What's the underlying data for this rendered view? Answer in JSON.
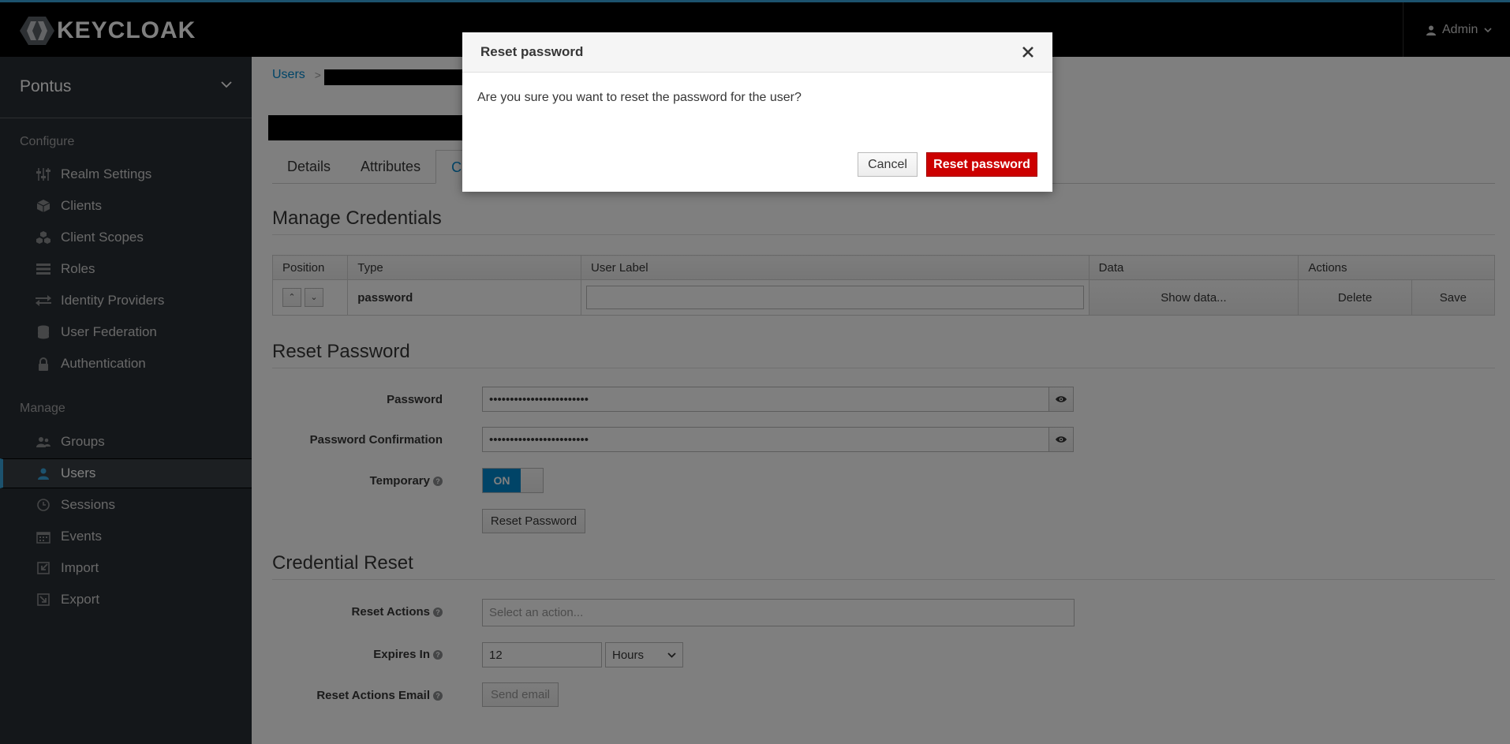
{
  "header": {
    "logo_text": "KEYCLOAK",
    "user_label": "Admin"
  },
  "sidebar": {
    "realm": "Pontus",
    "configure_heading": "Configure",
    "configure_items": [
      {
        "label": "Realm Settings",
        "icon": "sliders-icon"
      },
      {
        "label": "Clients",
        "icon": "cube-icon"
      },
      {
        "label": "Client Scopes",
        "icon": "cubes-icon"
      },
      {
        "label": "Roles",
        "icon": "list-icon"
      },
      {
        "label": "Identity Providers",
        "icon": "exchange-icon"
      },
      {
        "label": "User Federation",
        "icon": "database-icon"
      },
      {
        "label": "Authentication",
        "icon": "lock-icon"
      }
    ],
    "manage_heading": "Manage",
    "manage_items": [
      {
        "label": "Groups",
        "icon": "users-icon"
      },
      {
        "label": "Users",
        "icon": "user-icon",
        "active": true
      },
      {
        "label": "Sessions",
        "icon": "clock-icon"
      },
      {
        "label": "Events",
        "icon": "calendar-icon"
      },
      {
        "label": "Import",
        "icon": "import-icon"
      },
      {
        "label": "Export",
        "icon": "export-icon"
      }
    ]
  },
  "breadcrumb": {
    "root": "Users"
  },
  "tabs": [
    "Details",
    "Attributes",
    "C"
  ],
  "manage_credentials": {
    "title": "Manage Credentials",
    "columns": [
      "Position",
      "Type",
      "User Label",
      "Data",
      "Actions"
    ],
    "row": {
      "type": "password",
      "user_label": "",
      "data_button": "Show data...",
      "delete": "Delete",
      "save": "Save"
    }
  },
  "reset_password": {
    "title": "Reset Password",
    "password_label": "Password",
    "password_value": "••••••••••••••••••••••••",
    "confirm_label": "Password Confirmation",
    "confirm_value": "••••••••••••••••••••••••",
    "temporary_label": "Temporary",
    "temporary_value": "ON",
    "button": "Reset Password"
  },
  "credential_reset": {
    "title": "Credential Reset",
    "actions_label": "Reset Actions",
    "actions_placeholder": "Select an action...",
    "expires_label": "Expires In",
    "expires_value": "12",
    "expires_unit": "Hours",
    "email_label": "Reset Actions Email",
    "email_button": "Send email"
  },
  "modal": {
    "title": "Reset password",
    "message": "Are you sure you want to reset the password for the user?",
    "cancel": "Cancel",
    "confirm": "Reset password"
  },
  "colors": {
    "accent": "#0088ce",
    "danger": "#cc0000",
    "sidebar": "#292e34"
  }
}
